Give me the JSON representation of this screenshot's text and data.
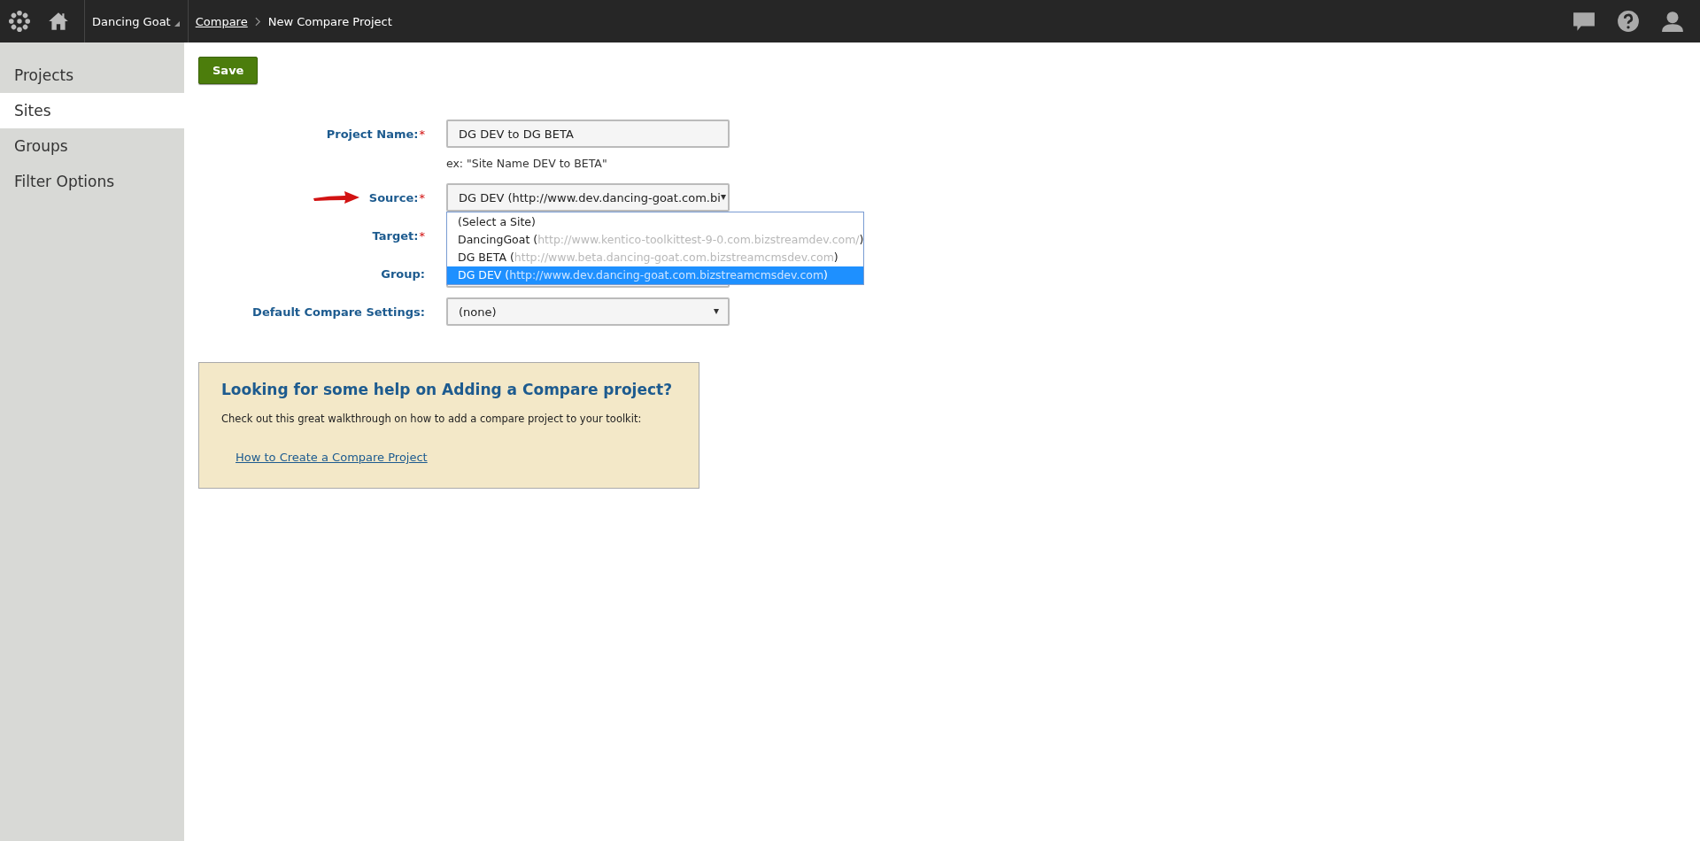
{
  "top_bar": {
    "site": "Dancing Goat",
    "breadcrumb": [
      {
        "label": "Compare",
        "link": true
      },
      {
        "label": "New Compare Project",
        "link": false
      }
    ]
  },
  "sidebar": {
    "items": [
      {
        "label": "Projects",
        "selected": false
      },
      {
        "label": "Sites",
        "selected": true
      },
      {
        "label": "Groups",
        "selected": false
      },
      {
        "label": "Filter Options",
        "selected": false
      }
    ]
  },
  "save_button": "Save",
  "form": {
    "fields": [
      {
        "kind": "text",
        "label": "Project Name:",
        "required_mark": "*",
        "value": "DG DEV to DG BETA",
        "hint": "ex: \"Site Name DEV to BETA\"",
        "pointer": false
      },
      {
        "kind": "select",
        "label": "Source:",
        "required_mark": "*",
        "value": "DG DEV (http://www.dev.dancing-goat.com.bi",
        "pointer": true,
        "open": true,
        "options": [
          {
            "name": "(Select a Site)",
            "selected": false
          },
          {
            "name": "DancingGoat (",
            "url": "http://www.kentico-toolkittest-9-0.com.bizstreamdev.com/",
            "close": ")",
            "selected": false
          },
          {
            "name": "DG BETA (",
            "url": "http://www.beta.dancing-goat.com.bizstreamcmsdev.com",
            "close": ")",
            "selected": false
          },
          {
            "name": "DG DEV (",
            "url": "http://www.dev.dancing-goat.com.bizstreamcmsdev.com",
            "close": ")",
            "selected": true
          }
        ]
      },
      {
        "kind": "select",
        "label": "Target:",
        "required_mark": "*",
        "pointer": false,
        "hidden": true
      },
      {
        "kind": "select",
        "label": "Group:",
        "pointer": false,
        "caret_hidden": true
      },
      {
        "kind": "select",
        "label": "Default Compare Settings:",
        "value": "(none)",
        "pointer": false
      }
    ]
  },
  "help": {
    "title": "Looking for some help on Adding a Compare project?",
    "text": "Check out this great walkthrough on how to add a compare project to your toolkit:",
    "link": "How to Create a Compare Project"
  }
}
